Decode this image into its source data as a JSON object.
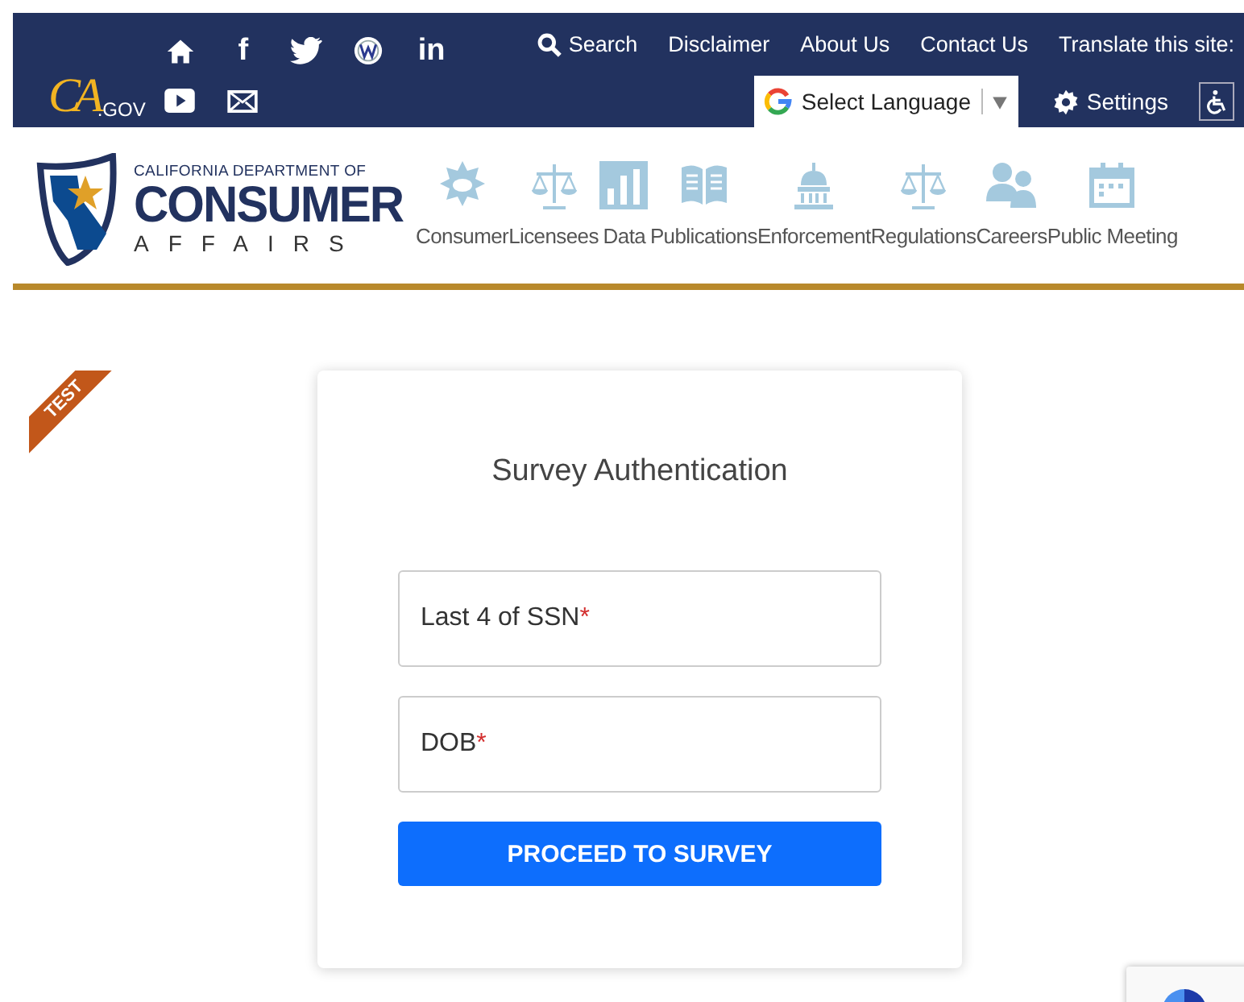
{
  "header": {
    "logo": {
      "mark": "CA",
      "suffix": ".GOV"
    },
    "social": [
      {
        "kind": "home"
      },
      {
        "kind": "facebook",
        "glyph": "f"
      },
      {
        "kind": "twitter"
      },
      {
        "kind": "wordpress"
      },
      {
        "kind": "linkedin",
        "glyph": "in"
      },
      {
        "kind": "youtube"
      },
      {
        "kind": "mail"
      }
    ],
    "links": [
      {
        "kind": "search",
        "label": "Search"
      },
      {
        "kind": "link",
        "label": "Disclaimer"
      },
      {
        "kind": "link",
        "label": "About Us"
      },
      {
        "kind": "link",
        "label": "Contact Us"
      },
      {
        "kind": "text",
        "label": "Translate this site:"
      }
    ],
    "language_select": {
      "value": "Select Language"
    },
    "settings": {
      "label": "Settings"
    }
  },
  "brand": {
    "line1": "CALIFORNIA DEPARTMENT OF",
    "line2": "CONSUMER",
    "line3": "AFFAIRS"
  },
  "nav": [
    {
      "kind": "badge",
      "label": "Consumer"
    },
    {
      "kind": "scales",
      "label": "Licensees"
    },
    {
      "kind": "chart",
      "label": "Data"
    },
    {
      "kind": "book",
      "label": "Publications"
    },
    {
      "kind": "dome",
      "label": "Enforcement"
    },
    {
      "kind": "scales",
      "label": "Regulations"
    },
    {
      "kind": "people",
      "label": "Careers"
    },
    {
      "kind": "calendar",
      "label": "Public Meeting"
    }
  ],
  "ribbon": {
    "label": "TEST"
  },
  "card": {
    "title": "Survey Authentication",
    "fields": [
      {
        "label": "Last 4 of SSN",
        "required_mark": "*"
      },
      {
        "label": "DOB",
        "required_mark": "*"
      }
    ],
    "button": "PROCEED TO SURVEY"
  }
}
